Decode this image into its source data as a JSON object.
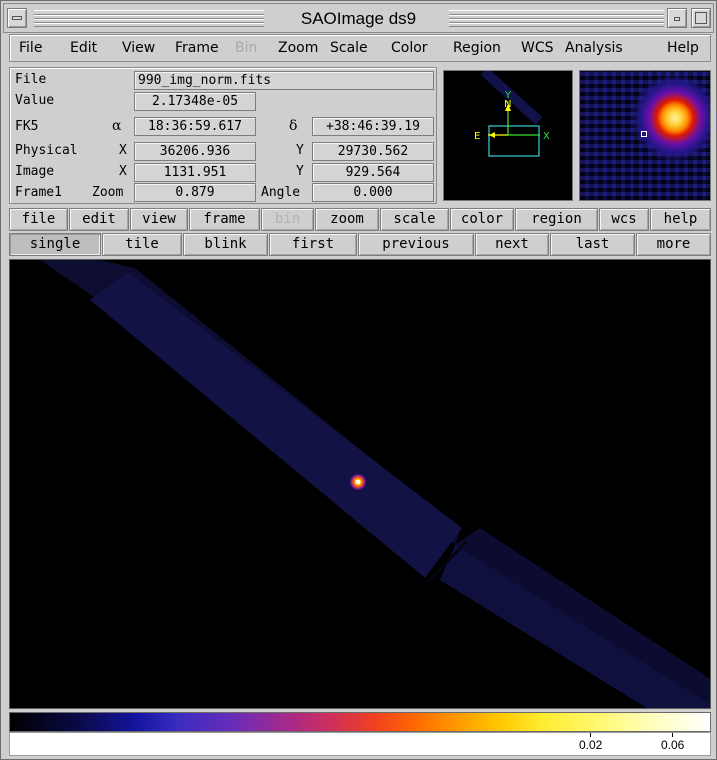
{
  "window": {
    "title": "SAOImage ds9"
  },
  "menubar": {
    "items": [
      "File",
      "Edit",
      "View",
      "Frame",
      "Bin",
      "Zoom",
      "Scale",
      "Color",
      "Region",
      "WCS",
      "Analysis",
      "Help"
    ],
    "disabled": [
      "Bin"
    ]
  },
  "info": {
    "file_label": "File",
    "file_value": "990_img_norm.fits",
    "value_label": "Value",
    "value_value": "2.17348e-05",
    "fk5_label": "FK5",
    "alpha_symbol": "α",
    "alpha_value": "18:36:59.617",
    "delta_symbol": "δ",
    "delta_value": "+38:46:39.19",
    "physical_label": "Physical",
    "physical_x_label": "X",
    "physical_x": "36206.936",
    "physical_y_label": "Y",
    "physical_y": "29730.562",
    "image_label": "Image",
    "image_x_label": "X",
    "image_x": "1131.951",
    "image_y_label": "Y",
    "image_y": "929.564",
    "frame_label": "Frame1",
    "zoom_label": "Zoom",
    "zoom_value": "0.879",
    "angle_label": "Angle",
    "angle_value": "0.000"
  },
  "panner": {
    "north_label": "N",
    "y_label": "Y",
    "east_label": "E",
    "x_label": "X"
  },
  "buttons_row1": [
    "file",
    "edit",
    "view",
    "frame",
    "bin",
    "zoom",
    "scale",
    "color",
    "region",
    "wcs",
    "help"
  ],
  "buttons_row1_disabled": [
    "bin"
  ],
  "buttons_row2": [
    "single",
    "tile",
    "blink",
    "first",
    "previous",
    "next",
    "last",
    "more"
  ],
  "buttons_row2_active": "single",
  "colorbar": {
    "tick_labels": [
      "0.02",
      "0.06"
    ],
    "colormap_colors": [
      "#000000",
      "#1414a0",
      "#a82a88",
      "#f04020",
      "#ffc800",
      "#ffffff"
    ]
  },
  "colors": {
    "background_gray": "#cfcfcf",
    "panner_box": "#3ad0d0",
    "compass": "#ffff00"
  }
}
